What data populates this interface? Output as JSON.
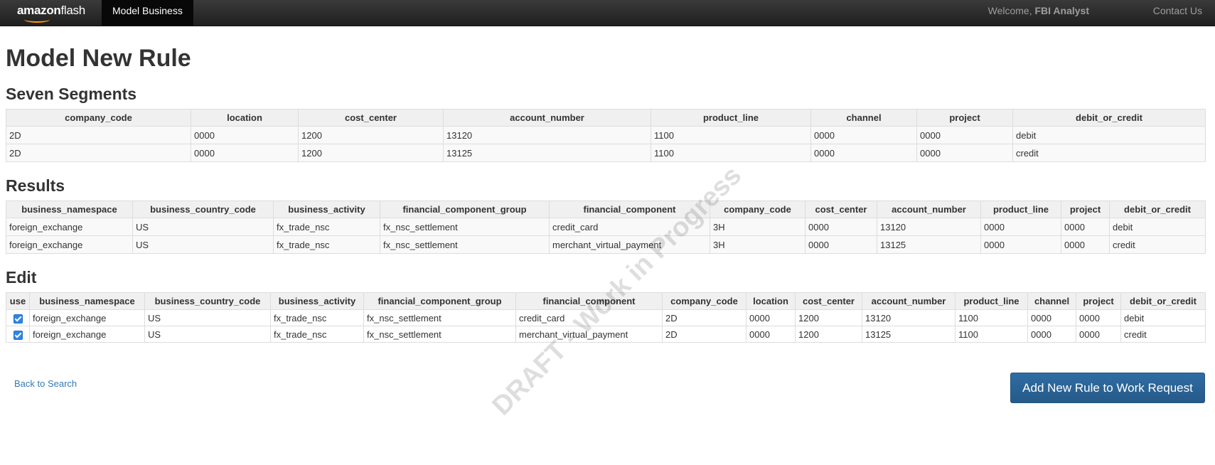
{
  "nav": {
    "brand_main": "amazon",
    "brand_sub": "flash",
    "active_item": "Model Business",
    "welcome_prefix": "Welcome,",
    "user_name": "FBI Analyst",
    "contact": "Contact Us"
  },
  "page_title": "Model New Rule",
  "watermark": "DRAFT - Work in Progress",
  "segments": {
    "heading": "Seven Segments",
    "columns": [
      "company_code",
      "location",
      "cost_center",
      "account_number",
      "product_line",
      "channel",
      "project",
      "debit_or_credit"
    ],
    "rows": [
      [
        "2D",
        "0000",
        "1200",
        "13120",
        "1100",
        "0000",
        "0000",
        "debit"
      ],
      [
        "2D",
        "0000",
        "1200",
        "13125",
        "1100",
        "0000",
        "0000",
        "credit"
      ]
    ]
  },
  "results": {
    "heading": "Results",
    "columns": [
      "business_namespace",
      "business_country_code",
      "business_activity",
      "financial_component_group",
      "financial_component",
      "company_code",
      "cost_center",
      "account_number",
      "product_line",
      "project",
      "debit_or_credit"
    ],
    "rows": [
      [
        "foreign_exchange",
        "US",
        "fx_trade_nsc",
        "fx_nsc_settlement",
        "credit_card",
        "3H",
        "0000",
        "13120",
        "0000",
        "0000",
        "debit"
      ],
      [
        "foreign_exchange",
        "US",
        "fx_trade_nsc",
        "fx_nsc_settlement",
        "merchant_virtual_payment",
        "3H",
        "0000",
        "13125",
        "0000",
        "0000",
        "credit"
      ]
    ]
  },
  "edit": {
    "heading": "Edit",
    "columns": [
      "use",
      "business_namespace",
      "business_country_code",
      "business_activity",
      "financial_component_group",
      "financial_component",
      "company_code",
      "location",
      "cost_center",
      "account_number",
      "product_line",
      "channel",
      "project",
      "debit_or_credit"
    ],
    "rows": [
      [
        "foreign_exchange",
        "US",
        "fx_trade_nsc",
        "fx_nsc_settlement",
        "credit_card",
        "2D",
        "0000",
        "1200",
        "13120",
        "1100",
        "0000",
        "0000",
        "debit"
      ],
      [
        "foreign_exchange",
        "US",
        "fx_trade_nsc",
        "fx_nsc_settlement",
        "merchant_virtual_payment",
        "2D",
        "0000",
        "1200",
        "13125",
        "1100",
        "0000",
        "0000",
        "credit"
      ]
    ]
  },
  "back_link": "Back to Search",
  "add_button": "Add New Rule to Work Request"
}
